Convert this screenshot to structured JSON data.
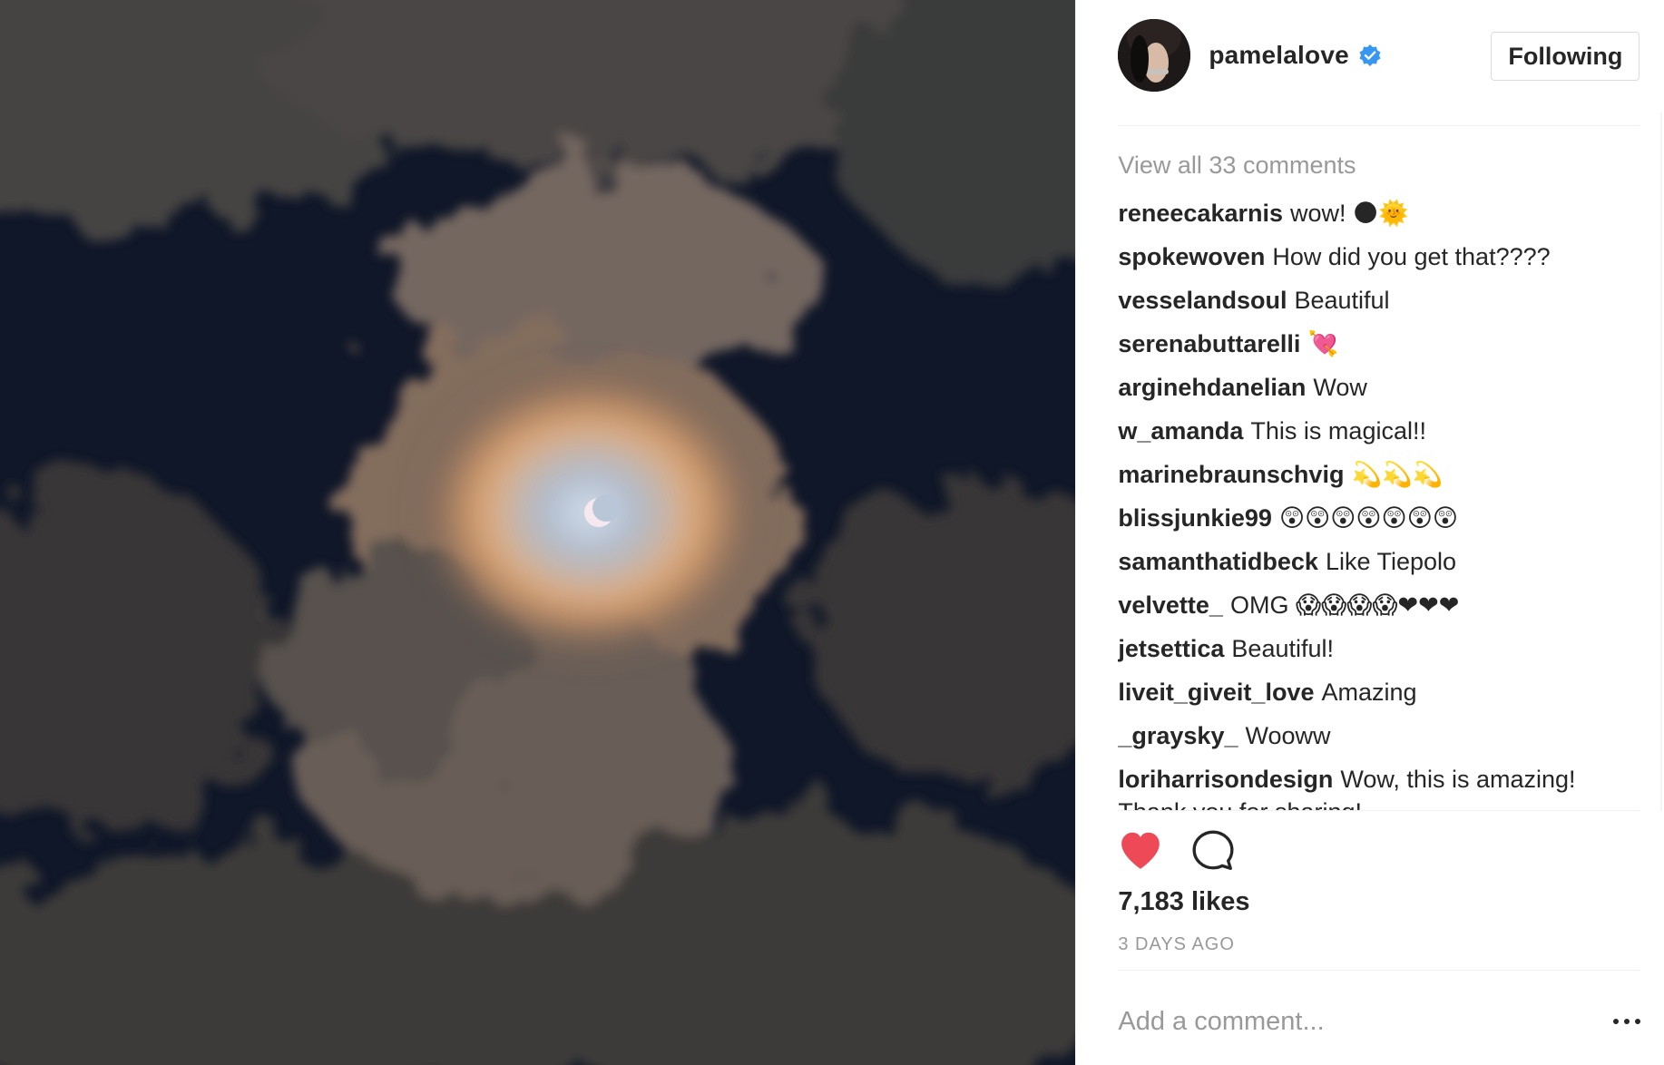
{
  "post": {
    "image_alt": "Partial solar eclipse through clouds",
    "author": {
      "username": "pamelalove",
      "verified": true,
      "follow_label": "Following"
    },
    "view_all_label": "View all 33 comments",
    "comments": [
      {
        "user": "reneecakarnis",
        "text": "wow! 🌑🌞"
      },
      {
        "user": "spokewoven",
        "text": "How did you get that????"
      },
      {
        "user": "vesselandsoul",
        "text": "Beautiful"
      },
      {
        "user": "serenabuttarelli",
        "text": "💘"
      },
      {
        "user": "arginehdanelian",
        "text": "Wow"
      },
      {
        "user": "w_amanda",
        "text": "This is magical!!"
      },
      {
        "user": "marinebraunschvig",
        "text": "💫💫💫"
      },
      {
        "user": "blissjunkie99",
        "text": "😲😲😲😲😲😲😲"
      },
      {
        "user": "samanthatidbeck",
        "text": "Like Tiepolo"
      },
      {
        "user": "velvette_",
        "text": "OMG 😱😱😱😱❤❤❤"
      },
      {
        "user": "jetsettica",
        "text": "Beautiful!"
      },
      {
        "user": "liveit_giveit_love",
        "text": "Amazing"
      },
      {
        "user": "_graysky_",
        "text": "Wooww"
      },
      {
        "user": "loriharrisondesign",
        "text": "Wow, this is amazing! Thank you for sharing!"
      }
    ],
    "likes_label": "7,183 likes",
    "timestamp": "3 DAYS AGO",
    "add_comment_placeholder": "Add a comment...",
    "icons": {
      "like": "heart-icon",
      "comment": "speech-bubble-icon",
      "more": "more-options-icon",
      "verified": "verified-badge-icon"
    },
    "colors": {
      "like_active": "#ed4956",
      "verified": "#3897f0",
      "text": "#262626",
      "muted": "#999999"
    }
  }
}
